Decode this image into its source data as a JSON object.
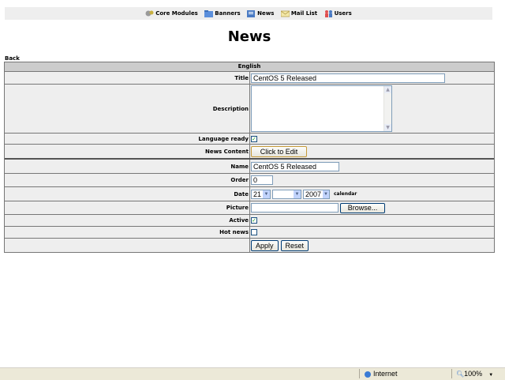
{
  "nav": {
    "items": [
      {
        "label": "Core Modules",
        "icon": "modules-icon",
        "color": "#8a8a8a"
      },
      {
        "label": "Banners",
        "icon": "folder-icon",
        "color": "#4a7fd1"
      },
      {
        "label": "News",
        "icon": "news-icon",
        "color": "#3c6db5"
      },
      {
        "label": "Mail List",
        "icon": "mail-icon",
        "color": "#e0c060"
      },
      {
        "label": "Users",
        "icon": "users-icon",
        "color": "#d84040"
      }
    ]
  },
  "page": {
    "title": "News",
    "back_label": "Back"
  },
  "form": {
    "section_label": "English",
    "title_label": "Title",
    "title_value": "CentOS 5 Released",
    "description_label": "Description",
    "description_value": "",
    "language_ready_label": "Language ready",
    "language_ready_checked": true,
    "news_content_label": "News Content",
    "edit_button": "Click to Edit",
    "name_label": "Name",
    "name_value": "CentOS 5 Released",
    "order_label": "Order",
    "order_value": "0",
    "date_label": "Date",
    "date_day": "21",
    "date_month": "",
    "date_year": "2007",
    "calendar_label": "calendar",
    "picture_label": "Picture",
    "picture_value": "",
    "browse_button": "Browse...",
    "active_label": "Active",
    "active_checked": true,
    "hot_news_label": "Hot news",
    "hot_news_checked": false,
    "apply_button": "Apply",
    "reset_button": "Reset"
  },
  "status": {
    "zone": "Internet",
    "zoom": "100%"
  }
}
